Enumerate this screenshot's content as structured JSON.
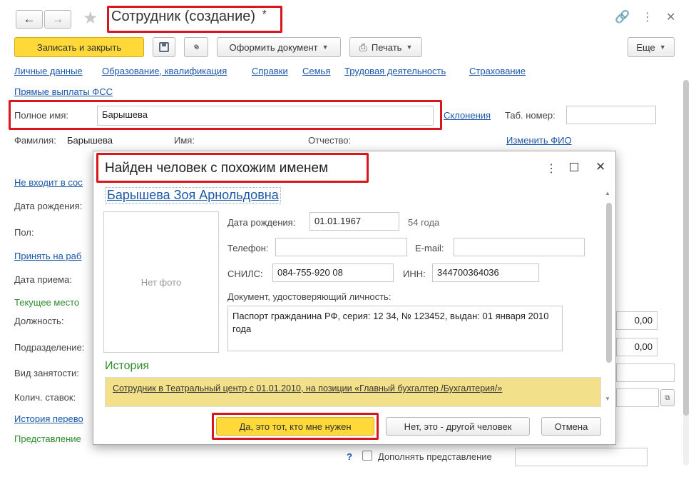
{
  "window": {
    "title": "Сотрудник (создание)",
    "modified_mark": "*",
    "icons": {
      "back": "arrow-left-icon",
      "forward": "arrow-right-icon",
      "favorite": "star-icon",
      "link": "link-icon",
      "menu": "kebab-menu-icon",
      "close": "close-icon"
    }
  },
  "toolbar": {
    "save_close": "Записать и закрыть",
    "save_icon": "floppy-disk-icon",
    "attach_icon": "paperclip-icon",
    "create_document": "Оформить документ",
    "print": "Печать",
    "more": "Еще"
  },
  "nav_links": [
    "Личные данные",
    "Образование, квалификация",
    "Справки",
    "Семья",
    "Трудовая деятельность",
    "Страхование",
    "Прямые выплаты ФСС"
  ],
  "form": {
    "full_name_label": "Полное имя:",
    "full_name_value": "Барышева",
    "declension_link": "Склонения",
    "tab_number_label": "Таб. номер:",
    "tab_number_value": "",
    "surname_label": "Фамилия:",
    "surname_value": "Барышева",
    "name_label": "Имя:",
    "patronymic_label": "Отчество:",
    "change_fio_link": "Изменить ФИО",
    "not_in_link": "Не входит в сос",
    "birth_date_label": "Дата рождения:",
    "gender_label": "Пол:",
    "hire_link": "Принять на раб",
    "hire_date_label": "Дата приема:",
    "current_place_label": "Текущее место",
    "position_label": "Должность:",
    "department_label": "Подразделение:",
    "employment_type_label": "Вид занятости:",
    "rates_label": "Колич. ставок:",
    "transfer_history_link": "История перево",
    "representation_label": "Представление",
    "value_1": "0,00",
    "value_2": "0,00",
    "help_mark": "?",
    "complete_representation": "Дополнять представление"
  },
  "dialog": {
    "title": "Найден человек с похожим именем",
    "person_name": "Барышева Зоя Арнольдовна",
    "no_photo": "Нет фото",
    "birth_date_label": "Дата рождения:",
    "birth_date_value": "01.01.1967",
    "age": "54 года",
    "phone_label": "Телефон:",
    "phone_value": "",
    "email_label": "E-mail:",
    "email_value": "",
    "snils_label": "СНИЛС:",
    "snils_value": "084-755-920 08",
    "inn_label": "ИНН:",
    "inn_value": "344700364036",
    "document_label": "Документ, удостоверяющий личность:",
    "document_value": "Паспорт гражданина РФ, серия: 12 34, № 123452, выдан: 01 января 2010 года",
    "history_label": "История",
    "history_entry": "Сотрудник в Театральный центр с 01.01.2010, на позиции «Главный бухгалтер /Бухгалтерия/»",
    "yes_button": "Да, это тот, кто мне нужен",
    "no_button": "Нет, это - другой человек",
    "cancel_button": "Отмена"
  },
  "colors": {
    "accent_yellow": "#ffd83a",
    "highlight_red": "#d7161e",
    "link_blue": "#1a57a8",
    "history_yellow": "#f2e08a",
    "green_text": "#2e8b2e"
  }
}
